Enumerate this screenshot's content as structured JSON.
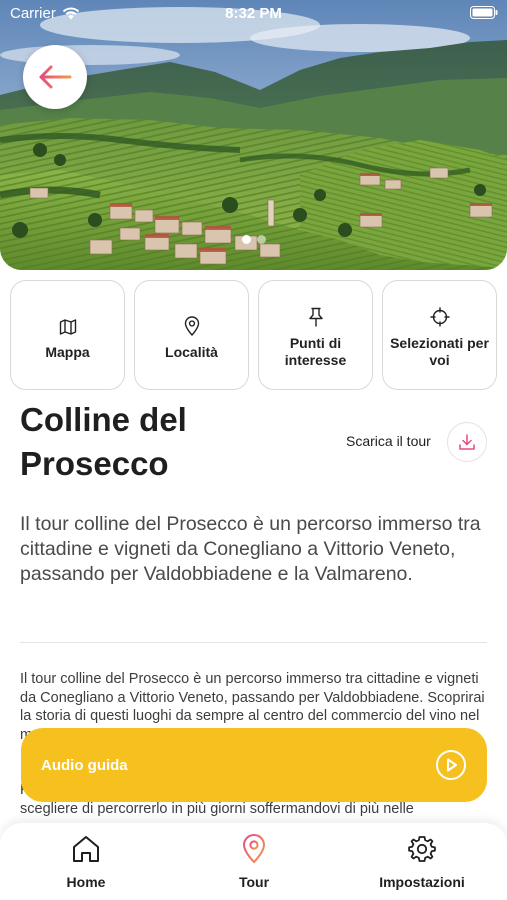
{
  "status_bar": {
    "carrier": "Carrier",
    "time": "8:32 PM"
  },
  "hero": {
    "image_icon": "vineyard-landscape-photo",
    "back_icon": "arrow-left-icon",
    "page_count": 2,
    "active_page": 1
  },
  "categories": [
    {
      "label": "Mappa",
      "icon": "map-icon"
    },
    {
      "label": "Località",
      "icon": "location-pin-icon"
    },
    {
      "label": "Punti di interesse",
      "icon": "pushpin-icon"
    },
    {
      "label": "Selezionati per voi",
      "icon": "crosshair-icon"
    }
  ],
  "tour": {
    "title": "Colline del Prosecco",
    "download_label": "Scarica il tour",
    "lead": "Il tour colline del Prosecco è un percorso immerso tra cittadine e vigneti da Conegliano a Vittorio Veneto, passando per Valdobbiadene e la Valmareno.",
    "body_paragraph_1": "Il tour colline del Prosecco è un percorso immerso tra cittadine e vigneti da Conegliano a Vittorio Veneto, passando per Valdobbiadene. Scoprirai la storia di questi luoghi da sempre al centro del commercio del vino nel mondo, e potrai",
    "body_paragraph_2": "Potete farlo in una giornata in maniera molto veloce, oppure potete scegliere di percorrerlo in più giorni soffermandovi di più nelle"
  },
  "audio_guide": {
    "label": "Audio guida",
    "icon": "play-circle-icon"
  },
  "tabbar": [
    {
      "label": "Home",
      "icon": "home-icon"
    },
    {
      "label": "Tour",
      "icon": "location-pin-icon"
    },
    {
      "label": "Impostazioni",
      "icon": "gear-icon"
    }
  ],
  "colors": {
    "accent_yellow": "#f6c11f",
    "accent_pink": "#e84a7f",
    "accent_orange": "#f2994a",
    "text": "#1f1f1f"
  }
}
